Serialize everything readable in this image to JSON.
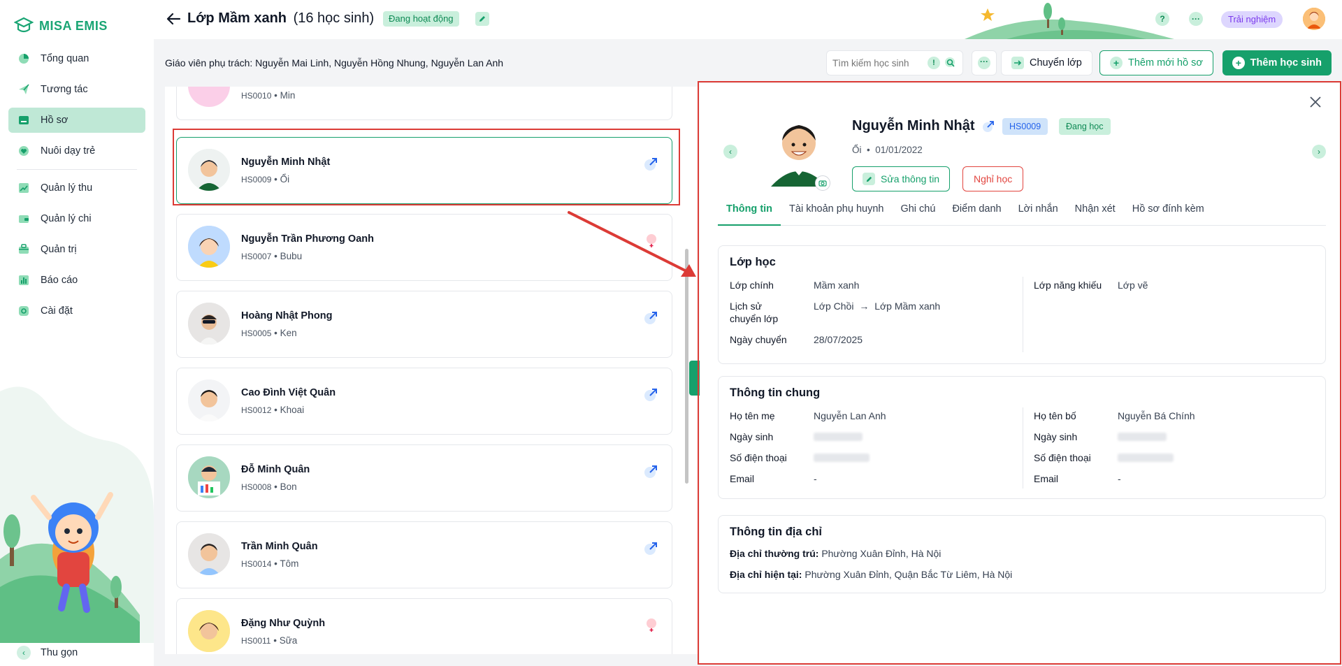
{
  "brand": {
    "name": "MISA EMIS"
  },
  "sidebar": {
    "items": [
      {
        "label": "Tổng quan",
        "icon": "pie-chart-icon",
        "active": false
      },
      {
        "label": "Tương tác",
        "icon": "paper-plane-icon",
        "active": false
      },
      {
        "label": "Hồ sơ",
        "icon": "folder-icon",
        "active": true
      },
      {
        "label": "Nuôi dạy trẻ",
        "icon": "heart-leaf-icon",
        "active": false
      },
      {
        "label": "Quản lý thu",
        "icon": "trend-chart-icon",
        "active": false
      },
      {
        "label": "Quản lý chi",
        "icon": "wallet-icon",
        "active": false
      },
      {
        "label": "Quản trị",
        "icon": "briefcase-icon",
        "active": false
      },
      {
        "label": "Báo cáo",
        "icon": "bar-chart-icon",
        "active": false
      },
      {
        "label": "Cài đặt",
        "icon": "gear-icon",
        "active": false
      }
    ],
    "collapse_label": "Thu gọn"
  },
  "header": {
    "title": "Lớp Mầm xanh",
    "count": "(16 học sinh)",
    "status": "Đang hoạt động",
    "trial_label": "Trải nghiệm"
  },
  "toolbar": {
    "teachers": "Giáo viên phụ trách: Nguyễn Mai Linh, Nguyễn Hồng Nhung, Nguyễn Lan Anh",
    "search_placeholder": "Tìm kiếm học sinh",
    "transfer_label": "Chuyển lớp",
    "new_profile_label": "Thêm mới hồ sơ",
    "add_student_label": "Thêm học sinh"
  },
  "students": [
    {
      "name": "",
      "code": "HS0010",
      "nick": "Min",
      "tag": "link"
    },
    {
      "name": "Nguyễn Minh Nhật",
      "code": "HS0009",
      "nick": "Ổi",
      "tag": "link"
    },
    {
      "name": "Nguyễn Trần Phương Oanh",
      "code": "HS0007",
      "nick": "Bubu",
      "tag": "female"
    },
    {
      "name": "Hoàng Nhật Phong",
      "code": "HS0005",
      "nick": "Ken",
      "tag": "link"
    },
    {
      "name": "Cao Đình Việt Quân",
      "code": "HS0012",
      "nick": "Khoai",
      "tag": "link"
    },
    {
      "name": "Đỗ Minh Quân",
      "code": "HS0008",
      "nick": "Bon",
      "tag": "link"
    },
    {
      "name": "Trần Minh Quân",
      "code": "HS0014",
      "nick": "Tôm",
      "tag": "link"
    },
    {
      "name": "Đặng Như Quỳnh",
      "code": "HS0011",
      "nick": "Sữa",
      "tag": "female"
    }
  ],
  "detail": {
    "name": "Nguyễn Minh Nhật",
    "code": "HS0009",
    "status": "Đang học",
    "nick": "Ổi",
    "dob": "01/01/2022",
    "edit_label": "Sửa thông tin",
    "leave_label": "Nghỉ học",
    "tabs": [
      "Thông tin",
      "Tài khoản phụ huynh",
      "Ghi chú",
      "Điểm danh",
      "Lời nhắn",
      "Nhận xét",
      "Hồ sơ đính kèm"
    ],
    "class_section": {
      "title": "Lớp học",
      "main_class_label": "Lớp chính",
      "main_class_value": "Mầm xanh",
      "history_label_1": "Lịch sử",
      "history_label_2": "chuyển lớp",
      "history_from": "Lớp Chồi",
      "history_to": "Lớp Mầm xanh",
      "transfer_date_label": "Ngày chuyển",
      "transfer_date_value": "28/07/2025",
      "talent_label": "Lớp năng khiếu",
      "talent_value": "Lớp vẽ"
    },
    "general_section": {
      "title": "Thông tin chung",
      "mother_name_label": "Họ tên mẹ",
      "mother_name_value": "Nguyễn Lan Anh",
      "father_name_label": "Họ tên bố",
      "father_name_value": "Nguyễn Bá Chính",
      "dob_label": "Ngày sinh",
      "phone_label": "Số điện thoại",
      "email_label": "Email",
      "mother_email": "-",
      "father_email": "-"
    },
    "address_section": {
      "title": "Thông tin địa chỉ",
      "permanent_label": "Địa chỉ thường trú:",
      "permanent_value": "Phường Xuân Đỉnh, Hà Nội",
      "current_label": "Địa chỉ hiện tại:",
      "current_value": "Phường Xuân Đỉnh, Quận Bắc Từ Liêm, Hà Nội"
    }
  },
  "colors": {
    "brand": "#16a06b",
    "highlight": "#dc3b36",
    "code_badge": "#cfe3fa"
  }
}
